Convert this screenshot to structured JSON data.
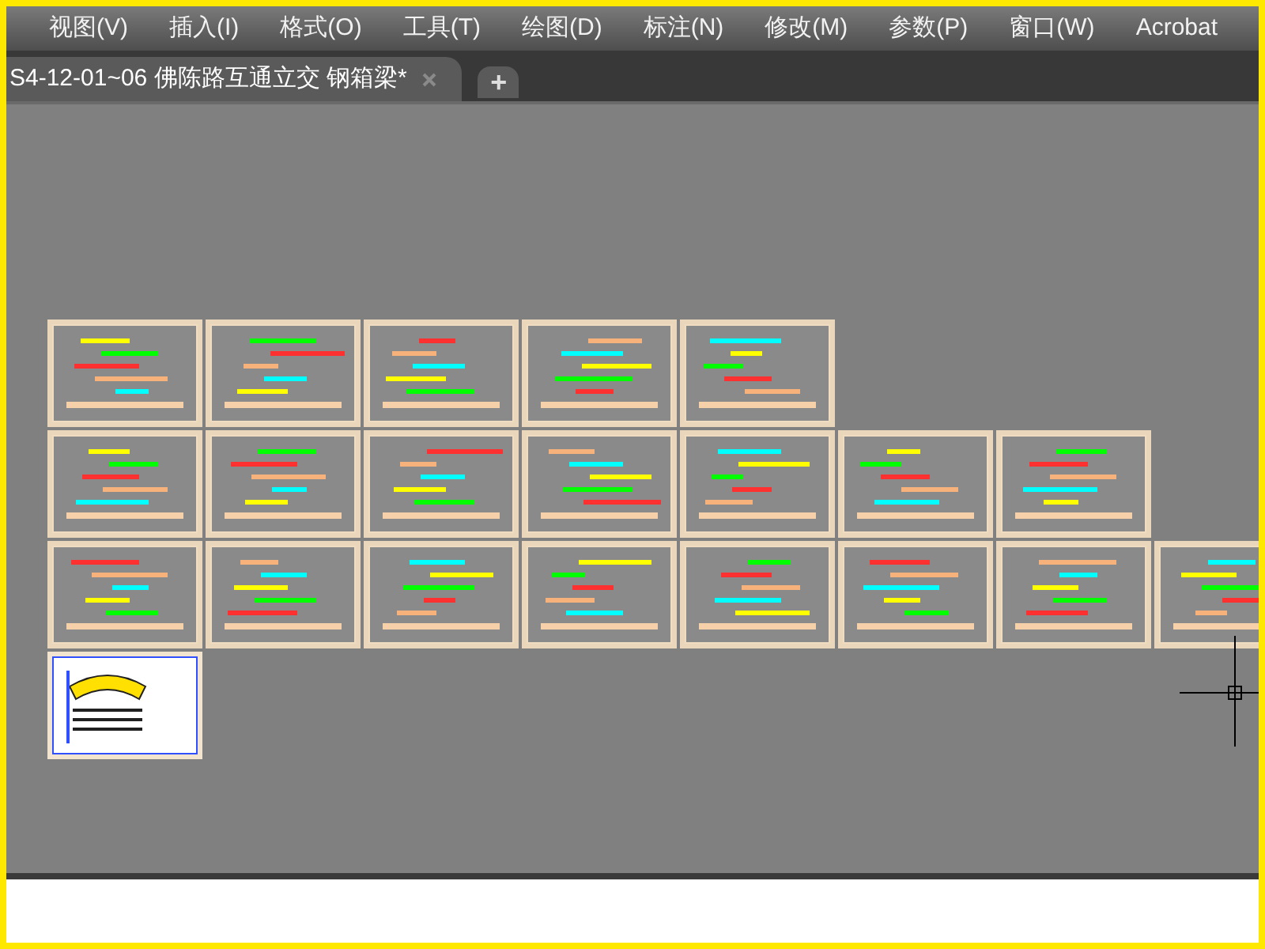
{
  "menu_bar": {
    "items": [
      "视图(V)",
      "插入(I)",
      "格式(O)",
      "工具(T)",
      "绘图(D)",
      "标注(N)",
      "修改(M)",
      "参数(P)",
      "窗口(W)",
      "Acrobat"
    ]
  },
  "tabs": [
    {
      "label": "S4-12-01~06 佛陈路互通立交 钢箱梁*",
      "selected": true
    }
  ],
  "new_tab": {
    "label": "+"
  }
}
